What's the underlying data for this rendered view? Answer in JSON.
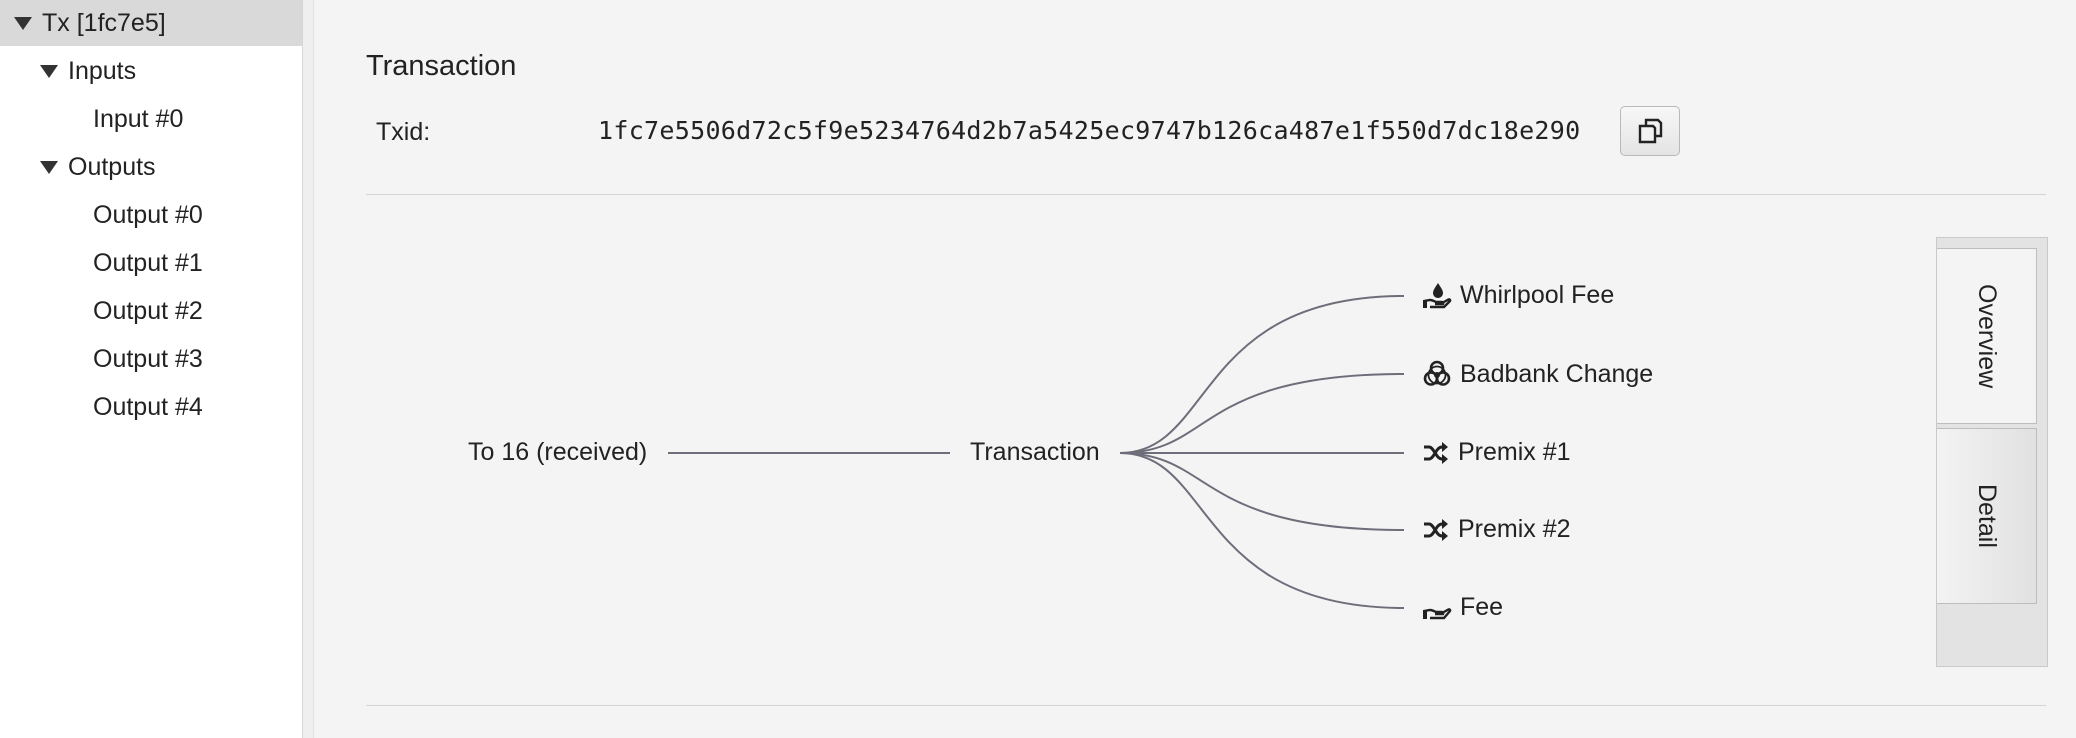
{
  "sidebar": {
    "root": "Tx [1fc7e5]",
    "inputs_label": "Inputs",
    "inputs": [
      "Input #0"
    ],
    "outputs_label": "Outputs",
    "outputs": [
      "Output #0",
      "Output #1",
      "Output #2",
      "Output #3",
      "Output #4"
    ]
  },
  "main": {
    "title": "Transaction",
    "txid_label": "Txid:",
    "txid": "1fc7e5506d72c5f9e5234764d2b7a5425ec9747b126ca487e1f550d7dc18e290",
    "copy_icon": "copy-icon"
  },
  "diagram": {
    "input_label": "To 16 (received)",
    "center_label": "Transaction",
    "outputs": [
      {
        "label": "Whirlpool Fee",
        "icon": "hand-holding-water-icon"
      },
      {
        "label": "Badbank Change",
        "icon": "biohazard-icon"
      },
      {
        "label": "Premix #1",
        "icon": "shuffle-icon"
      },
      {
        "label": "Premix #2",
        "icon": "shuffle-icon"
      },
      {
        "label": "Fee",
        "icon": "hand-holding-icon"
      }
    ],
    "line_color": "#6e6e7a"
  },
  "tabs": {
    "overview": "Overview",
    "detail": "Detail",
    "active": "Overview"
  }
}
